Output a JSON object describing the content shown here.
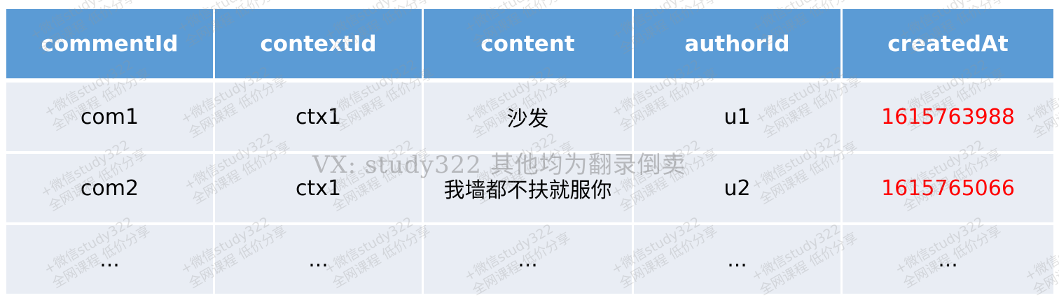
{
  "table": {
    "headers": [
      "commentId",
      "contextId",
      "content",
      "authorId",
      "createdAt"
    ],
    "rows": [
      [
        "com1",
        "ctx1",
        "沙发",
        "u1",
        "1615763988"
      ],
      [
        "com2",
        "ctx1",
        "我墙都不扶就服你",
        "u2",
        "1615765066"
      ],
      [
        "...",
        "...",
        "...",
        "...",
        "..."
      ]
    ]
  },
  "colors": {
    "header_bg": "#5b9bd5",
    "cell_bg": "#e9edf4",
    "timestamp_text": "#ff0000"
  },
  "watermark": {
    "center_text": "VX: study322 其他均为翻录倒卖",
    "tile_line1": "+微信study322",
    "tile_line2": "全网课程 低价分享"
  }
}
